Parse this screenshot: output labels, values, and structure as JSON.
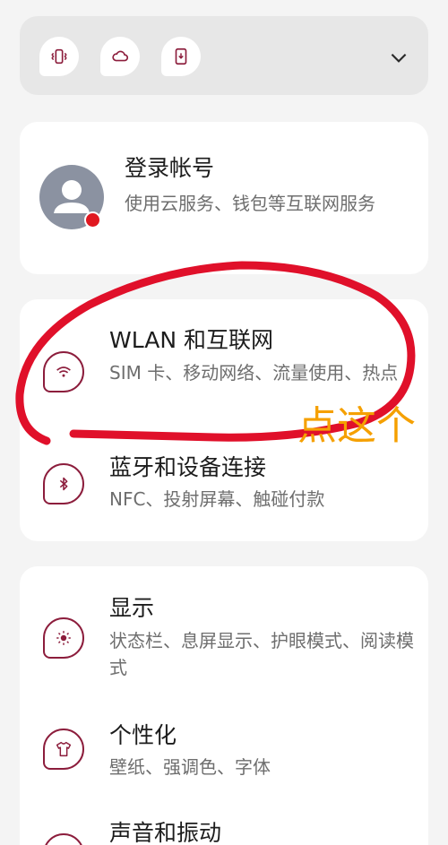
{
  "colors": {
    "accent": "#8c1d3c",
    "annotation_red": "#e0102a",
    "annotation_orange": "#f5a000",
    "badge_red": "#e01820"
  },
  "quick_toggles": [
    {
      "icon": "vibrate-icon"
    },
    {
      "icon": "cloud-icon"
    },
    {
      "icon": "phone-download-icon"
    }
  ],
  "account": {
    "title": "登录帐号",
    "subtitle": "使用云服务、钱包等互联网服务"
  },
  "network": {
    "wlan": {
      "title": "WLAN 和互联网",
      "subtitle": "SIM 卡、移动网络、流量使用、热点",
      "icon": "wifi-icon"
    },
    "bluetooth": {
      "title": "蓝牙和设备连接",
      "subtitle": "NFC、投射屏幕、触碰付款",
      "icon": "bluetooth-icon"
    }
  },
  "display_group": {
    "display": {
      "title": "显示",
      "subtitle": "状态栏、息屏显示、护眼模式、阅读模式",
      "icon": "brightness-icon"
    },
    "personalize": {
      "title": "个性化",
      "subtitle": "壁纸、强调色、字体",
      "icon": "tshirt-icon"
    },
    "sound": {
      "title": "声音和振动",
      "icon": "speaker-icon"
    }
  },
  "annotation": {
    "text": "点这个"
  }
}
